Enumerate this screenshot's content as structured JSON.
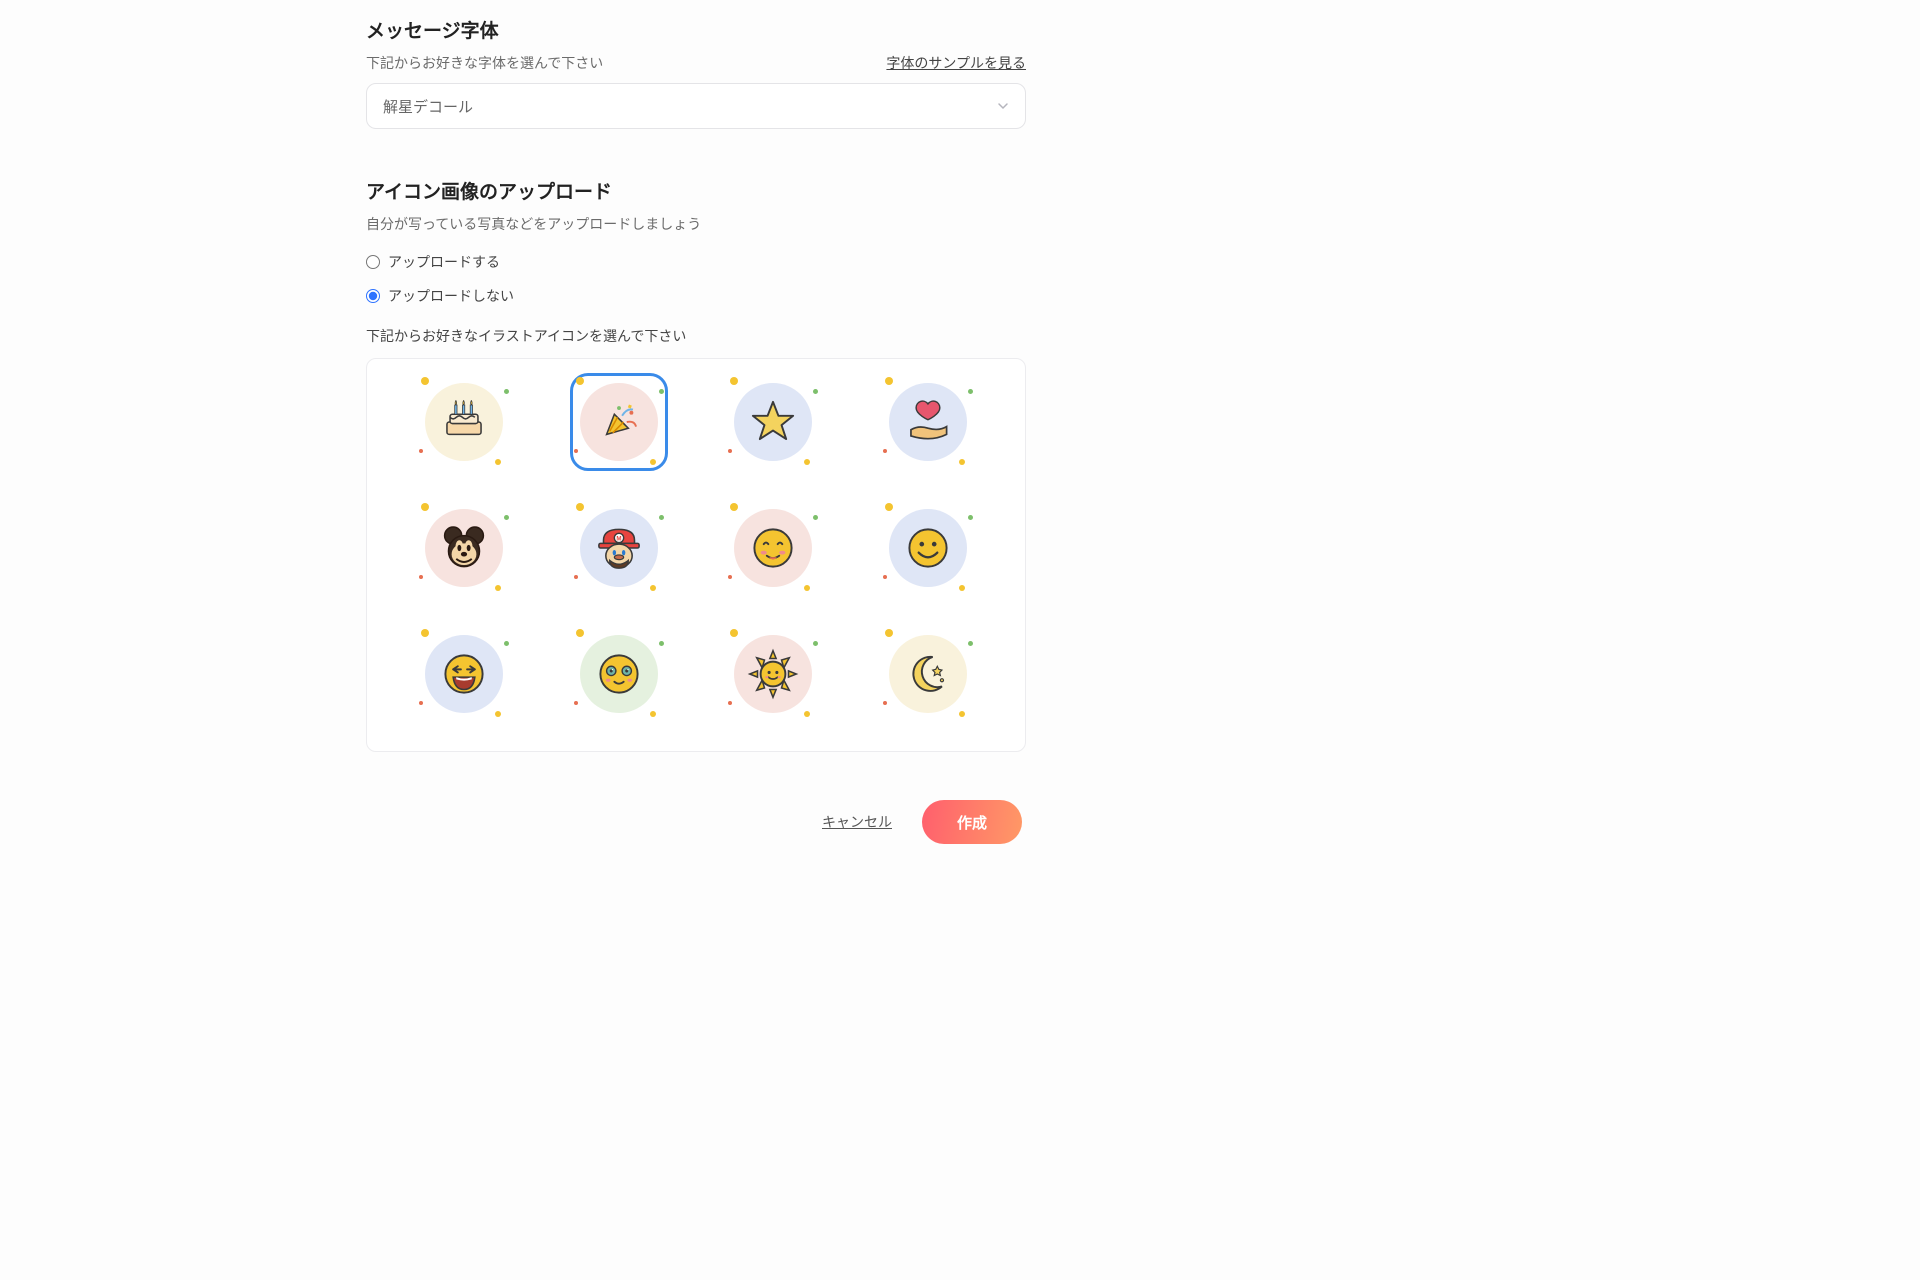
{
  "font_section": {
    "title": "メッセージ字体",
    "help": "下記からお好きな字体を選んで下さい",
    "sample_link": "字体のサンプルを見る",
    "selected": "解星デコール"
  },
  "icon_section": {
    "title": "アイコン画像のアップロード",
    "help": "自分が写っている写真などをアップロードしましょう",
    "radio_upload": "アップロードする",
    "radio_noupload": "アップロードしない",
    "grid_help": "下記からお好きなイラストアイコンを選んで下さい",
    "selected_index": 1,
    "icons": [
      {
        "name": "birthday-cake-icon",
        "bg": "bg-cream"
      },
      {
        "name": "confetti-popper-icon",
        "bg": "bg-pink"
      },
      {
        "name": "star-icon",
        "bg": "bg-blue"
      },
      {
        "name": "hand-heart-icon",
        "bg": "bg-blue"
      },
      {
        "name": "mickey-icon",
        "bg": "bg-pink"
      },
      {
        "name": "mario-icon",
        "bg": "bg-blue"
      },
      {
        "name": "blush-face-icon",
        "bg": "bg-pink"
      },
      {
        "name": "smiley-icon",
        "bg": "bg-blue"
      },
      {
        "name": "laughing-face-icon",
        "bg": "bg-blue"
      },
      {
        "name": "cute-face-icon",
        "bg": "bg-green"
      },
      {
        "name": "sun-icon",
        "bg": "bg-pink"
      },
      {
        "name": "moon-stars-icon",
        "bg": "bg-cream"
      },
      {
        "name": "icon-13",
        "bg": "bg-blue"
      },
      {
        "name": "icon-14",
        "bg": "bg-pink"
      },
      {
        "name": "icon-15",
        "bg": "bg-blue"
      },
      {
        "name": "icon-16",
        "bg": "bg-cream"
      }
    ]
  },
  "footer": {
    "cancel": "キャンセル",
    "create": "作成"
  }
}
